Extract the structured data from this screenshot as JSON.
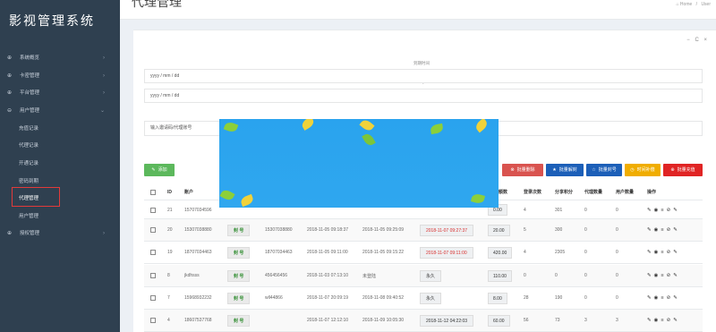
{
  "sidebar": {
    "brand": "影视管理系统",
    "menu": [
      {
        "label": "系统概览",
        "icon": "⊕"
      },
      {
        "label": "卡密管理",
        "icon": "⊕"
      },
      {
        "label": "平台管理",
        "icon": "⊕"
      },
      {
        "label": "用户管理",
        "icon": "⊖"
      }
    ],
    "submenu": [
      "充值记录",
      "代理记录",
      "开通记录",
      "密码到期",
      "代理管理",
      "用户管理"
    ],
    "last": {
      "label": "授权管理",
      "icon": "⊕"
    }
  },
  "header": {
    "title": "代理管理",
    "breadcrumb": [
      "Home",
      "User"
    ]
  },
  "panel": {
    "tools": [
      "−",
      "C",
      "×"
    ],
    "date_caption": "到期时间",
    "date_from_placeholder": "yyyy / mm / dd",
    "date_to_placeholder": "yyyy / mm / dd",
    "dash": "-",
    "search_placeholder": "输入邀请码/代理账号",
    "add_label": "添加",
    "actions": [
      {
        "label": "批量删除",
        "color": "#d9534f",
        "icon": "⊗"
      },
      {
        "label": "批量解封",
        "color": "#1c5fb8",
        "icon": "★"
      },
      {
        "label": "批量封号",
        "color": "#1c5fb8",
        "icon": "☆"
      },
      {
        "label": "时间补偿",
        "color": "#f0ad00",
        "icon": "◷"
      },
      {
        "label": "批量充值",
        "color": "#e02424",
        "icon": "⊕"
      }
    ]
  },
  "table": {
    "columns": [
      "ID",
      "账户",
      "",
      "",
      "",
      "",
      "额数",
      "登录次数",
      "分享积分",
      "代理数量",
      "用户数量",
      "操作"
    ],
    "rows": [
      {
        "id": "21",
        "account": "15707034596",
        "seal": "",
        "invite": "",
        "created": "",
        "login": "",
        "expiry": "",
        "expiry_red": false,
        "amount": "0.00",
        "logins": "4",
        "points": "301",
        "agents": "0",
        "users": "0"
      },
      {
        "id": "20",
        "account": "15307038880",
        "seal": "封 号",
        "invite": "15307038880",
        "created": "2018-11-05 09:18:37",
        "login": "2018-11-05 09:25:09",
        "expiry": "2018-11-07 09:27:37",
        "expiry_red": true,
        "amount": "20.00",
        "logins": "5",
        "points": "300",
        "agents": "0",
        "users": "0"
      },
      {
        "id": "19",
        "account": "18707034463",
        "seal": "封 号",
        "invite": "18707034463",
        "created": "2018-11-05 09:11:00",
        "login": "2018-11-05 09:15:22",
        "expiry": "2018-11-07 09:11:00",
        "expiry_red": true,
        "amount": "420.00",
        "logins": "4",
        "points": "2305",
        "agents": "0",
        "users": "0"
      },
      {
        "id": "8",
        "account": "jkdhsss",
        "seal": "封 号",
        "invite": "456456456",
        "created": "2018-11-03 07:13:10",
        "login": "未登陆",
        "expiry": "永久",
        "expiry_red": false,
        "amount": "110.00",
        "logins": "0",
        "points": "0",
        "agents": "0",
        "users": "0"
      },
      {
        "id": "7",
        "account": "15968932232",
        "seal": "封 号",
        "invite": "wll44866",
        "created": "2018-11-07 20:09:19",
        "login": "2018-11-08 09:40:52",
        "expiry": "永久",
        "expiry_red": false,
        "amount": "8.00",
        "logins": "28",
        "points": "190",
        "agents": "0",
        "users": "0"
      },
      {
        "id": "4",
        "account": "18607537768",
        "seal": "封 号",
        "invite": "",
        "created": "2018-11-07 12:12:10",
        "login": "2018-11-09 10:05:30",
        "expiry": "2018-11-12 04:22:03",
        "expiry_red": false,
        "amount": "60.00",
        "logins": "56",
        "points": "73",
        "agents": "3",
        "users": "3"
      }
    ],
    "ops_icons": [
      "✎",
      "◉",
      "≡",
      "⊘",
      "✎"
    ]
  }
}
